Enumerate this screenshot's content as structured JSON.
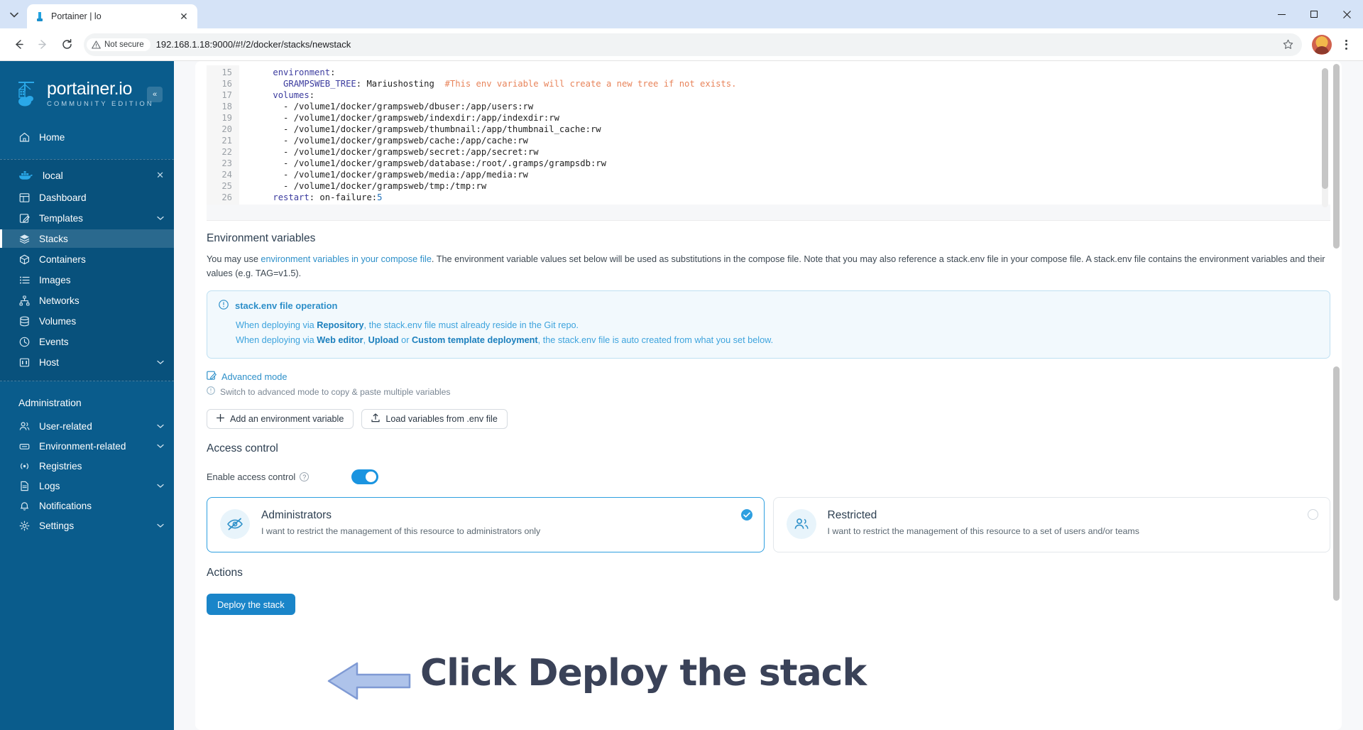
{
  "browser": {
    "tab_title": "Portainer | lo",
    "tab_close": "✕",
    "security_label": "Not secure",
    "url": "192.168.1.18:9000/#!/2/docker/stacks/newstack",
    "minimize": "—",
    "maximize": "▢",
    "close": "✕"
  },
  "sidebar": {
    "logo_title": "portainer.io",
    "logo_subtitle": "COMMUNITY EDITION",
    "collapse_label": "«",
    "home": {
      "label": "Home",
      "icon": "home-icon"
    },
    "environment": {
      "label": "local",
      "close": "✕",
      "icon": "docker-whale-icon"
    },
    "env_items": [
      {
        "label": "Dashboard",
        "icon": "dashboard-icon",
        "chevron": "",
        "active": false
      },
      {
        "label": "Templates",
        "icon": "templates-icon",
        "chevron": "⌄",
        "active": false
      },
      {
        "label": "Stacks",
        "icon": "stacks-icon",
        "chevron": "",
        "active": true
      },
      {
        "label": "Containers",
        "icon": "containers-icon",
        "chevron": "",
        "active": false
      },
      {
        "label": "Images",
        "icon": "images-icon",
        "chevron": "",
        "active": false
      },
      {
        "label": "Networks",
        "icon": "networks-icon",
        "chevron": "",
        "active": false
      },
      {
        "label": "Volumes",
        "icon": "volumes-icon",
        "chevron": "",
        "active": false
      },
      {
        "label": "Events",
        "icon": "events-icon",
        "chevron": "",
        "active": false
      },
      {
        "label": "Host",
        "icon": "host-icon",
        "chevron": "⌄",
        "active": false
      }
    ],
    "admin_title": "Administration",
    "admin_items": [
      {
        "label": "User-related",
        "icon": "users-icon",
        "chevron": "⌄"
      },
      {
        "label": "Environment-related",
        "icon": "environment-icon",
        "chevron": "⌄"
      },
      {
        "label": "Registries",
        "icon": "registries-icon",
        "chevron": ""
      },
      {
        "label": "Logs",
        "icon": "logs-icon",
        "chevron": "⌄"
      },
      {
        "label": "Notifications",
        "icon": "notifications-icon",
        "chevron": ""
      },
      {
        "label": "Settings",
        "icon": "settings-icon",
        "chevron": "⌄"
      }
    ]
  },
  "editor": {
    "lines": [
      {
        "num": "15",
        "indent": 4,
        "segments": [
          {
            "text": "environment",
            "cls": "tok-key"
          },
          {
            "text": ":",
            "cls": "tok-plain"
          }
        ]
      },
      {
        "num": "16",
        "indent": 6,
        "segments": [
          {
            "text": "GRAMPSWEB_TREE",
            "cls": "tok-key"
          },
          {
            "text": ": Mariushosting  ",
            "cls": "tok-plain"
          },
          {
            "text": "#This env variable will create a new tree if not exists.",
            "cls": "tok-comment"
          }
        ]
      },
      {
        "num": "17",
        "indent": 4,
        "segments": [
          {
            "text": "volumes",
            "cls": "tok-key"
          },
          {
            "text": ":",
            "cls": "tok-plain"
          }
        ]
      },
      {
        "num": "18",
        "indent": 6,
        "segments": [
          {
            "text": "- /volume1/docker/grampsweb/dbuser:/app/users:rw",
            "cls": "tok-plain"
          }
        ]
      },
      {
        "num": "19",
        "indent": 6,
        "segments": [
          {
            "text": "- /volume1/docker/grampsweb/indexdir:/app/indexdir:rw",
            "cls": "tok-plain"
          }
        ]
      },
      {
        "num": "20",
        "indent": 6,
        "segments": [
          {
            "text": "- /volume1/docker/grampsweb/thumbnail:/app/thumbnail_cache:rw",
            "cls": "tok-plain"
          }
        ]
      },
      {
        "num": "21",
        "indent": 6,
        "segments": [
          {
            "text": "- /volume1/docker/grampsweb/cache:/app/cache:rw",
            "cls": "tok-plain"
          }
        ]
      },
      {
        "num": "22",
        "indent": 6,
        "segments": [
          {
            "text": "- /volume1/docker/grampsweb/secret:/app/secret:rw",
            "cls": "tok-plain"
          }
        ]
      },
      {
        "num": "23",
        "indent": 6,
        "segments": [
          {
            "text": "- /volume1/docker/grampsweb/database:/root/.gramps/grampsdb:rw",
            "cls": "tok-plain"
          }
        ]
      },
      {
        "num": "24",
        "indent": 6,
        "segments": [
          {
            "text": "- /volume1/docker/grampsweb/media:/app/media:rw",
            "cls": "tok-plain"
          }
        ]
      },
      {
        "num": "25",
        "indent": 6,
        "segments": [
          {
            "text": "- /volume1/docker/grampsweb/tmp:/tmp:rw",
            "cls": "tok-plain"
          }
        ]
      },
      {
        "num": "26",
        "indent": 4,
        "segments": [
          {
            "text": "restart",
            "cls": "tok-key"
          },
          {
            "text": ": on-failure:",
            "cls": "tok-plain"
          },
          {
            "text": "5",
            "cls": "tok-num"
          }
        ]
      }
    ]
  },
  "env_section": {
    "title": "Environment variables",
    "desc_pre": "You may use ",
    "desc_link": "environment variables in your compose file",
    "desc_post": ". The environment variable values set below will be used as substitutions in the compose file. Note that you may also reference a stack.env file in your compose file. A stack.env file contains the environment variables and their values (e.g. TAG=v1.5).",
    "info": {
      "icon": "info-circle-icon",
      "title": "stack.env file operation",
      "line1_pre": "When deploying via ",
      "line1_bold": "Repository",
      "line1_post": ", the stack.env file must already reside in the Git repo.",
      "line2_pre": "When deploying via ",
      "line2_bold1": "Web editor",
      "line2_mid1": ", ",
      "line2_bold2": "Upload",
      "line2_mid2": " or ",
      "line2_bold3": "Custom template deployment",
      "line2_post": ", the stack.env file is auto created from what you set below."
    },
    "advanced_mode": "Advanced mode",
    "advanced_hint": "Switch to advanced mode to copy & paste multiple variables",
    "add_var_button": "Add an environment variable",
    "load_env_button": "Load variables from .env file"
  },
  "access_control": {
    "title": "Access control",
    "toggle_label": "Enable access control",
    "toggle_on": true,
    "cards": [
      {
        "title": "Administrators",
        "desc": "I want to restrict the management of this resource to administrators only",
        "icon": "admin-eye-icon",
        "selected": true
      },
      {
        "title": "Restricted",
        "desc": "I want to restrict the management of this resource to a set of users and/or teams",
        "icon": "users-group-icon",
        "selected": false
      }
    ]
  },
  "actions": {
    "title": "Actions",
    "deploy_button": "Deploy the stack"
  },
  "annotation": {
    "text": "Click Deploy the stack",
    "arrow_color": "#9bb6e8",
    "text_color": "#3a4258"
  },
  "colors": {
    "sidebar_bg": "#0a5c8c",
    "primary": "#1a85c9",
    "accent": "#2e9fe0",
    "link": "#2e90c9"
  }
}
